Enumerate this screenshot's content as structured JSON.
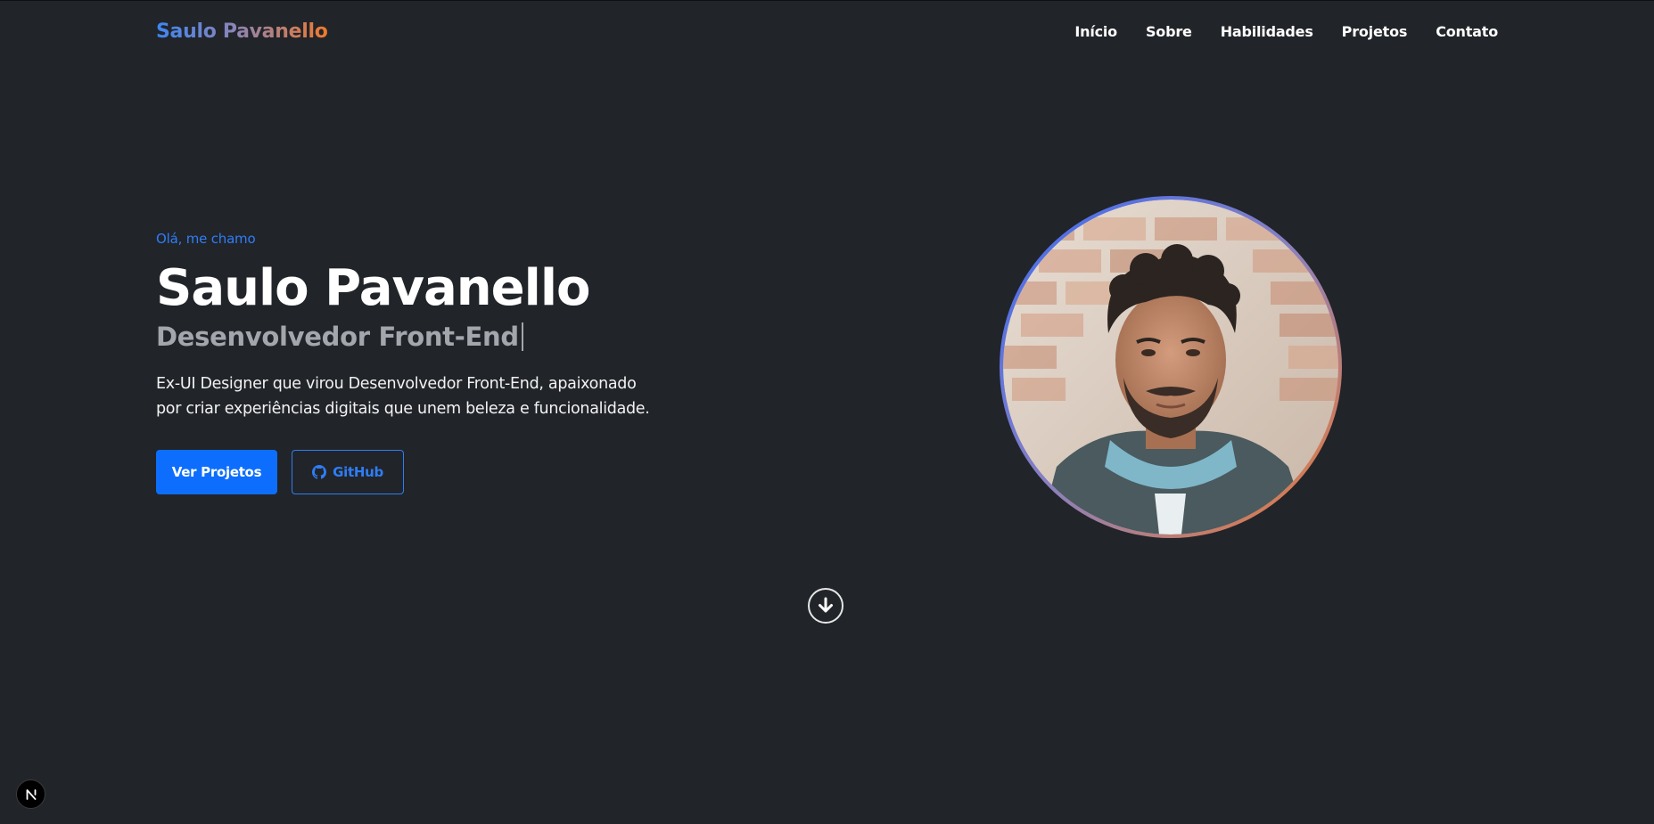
{
  "nav": {
    "brand": "Saulo Pavanello",
    "links": [
      "Início",
      "Sobre",
      "Habilidades",
      "Projetos",
      "Contato"
    ]
  },
  "hero": {
    "greeting": "Olá, me chamo",
    "name": "Saulo Pavanello",
    "role": "Desenvolvedor Front-End",
    "description": "Ex-UI Designer que virou Desenvolvedor Front-End, apaixonado por criar experiências digitais que unem beleza e funcionalidade.",
    "primary_button": "Ver Projetos",
    "secondary_button": "GitHub"
  },
  "colors": {
    "background": "#212429",
    "accent": "#0d6efd",
    "brand_gradient": [
      "#3d86f4",
      "#8a84b8",
      "#f07a2c"
    ]
  },
  "icons": {
    "github": "github-icon",
    "scroll": "arrow-down-circle-icon",
    "badge": "nextjs-icon"
  },
  "badge": {
    "letter": "N"
  }
}
